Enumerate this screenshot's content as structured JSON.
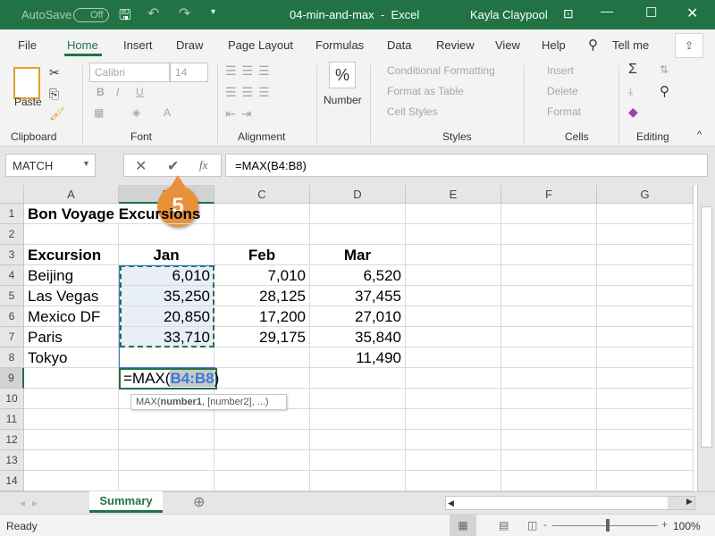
{
  "titlebar": {
    "autosave": "AutoSave",
    "autosave_state": "Off",
    "filename": "04-min-and-max",
    "app": "Excel",
    "user": "Kayla Claypool"
  },
  "menu": [
    "File",
    "Home",
    "Insert",
    "Draw",
    "Page Layout",
    "Formulas",
    "Data",
    "Review",
    "View",
    "Help"
  ],
  "tell_me": "Tell me",
  "ribbon": {
    "clipboard": {
      "label": "Clipboard",
      "paste": "Paste"
    },
    "font": {
      "label": "Font",
      "name": "Calibri",
      "size": "14",
      "bold": "B",
      "italic": "I",
      "underline": "U"
    },
    "alignment": {
      "label": "Alignment"
    },
    "number": {
      "label": "Number",
      "symbol": "%"
    },
    "styles": {
      "label": "Styles",
      "items": [
        "Conditional Formatting",
        "Format as Table",
        "Cell Styles"
      ]
    },
    "cells": {
      "label": "Cells",
      "items": [
        "Insert",
        "Delete",
        "Format"
      ]
    },
    "editing": {
      "label": "Editing"
    }
  },
  "formula_bar": {
    "name_box": "MATCH",
    "formula": "=MAX(B4:B8)",
    "fx": "fx"
  },
  "callout": "5",
  "columns": [
    "A",
    "B",
    "C",
    "D",
    "E",
    "F",
    "G"
  ],
  "rows": [
    {
      "n": "1",
      "cells": [
        "Bon Voyage Excursions",
        "",
        "",
        ""
      ]
    },
    {
      "n": "2",
      "cells": [
        "",
        "",
        "",
        ""
      ]
    },
    {
      "n": "3",
      "cells": [
        "Excursion",
        "Jan",
        "Feb",
        "Mar"
      ]
    },
    {
      "n": "4",
      "cells": [
        "Beijing",
        "6,010",
        "7,010",
        "6,520"
      ]
    },
    {
      "n": "5",
      "cells": [
        "Las Vegas",
        "35,250",
        "28,125",
        "37,455"
      ]
    },
    {
      "n": "6",
      "cells": [
        "Mexico DF",
        "20,850",
        "17,200",
        "27,010"
      ]
    },
    {
      "n": "7",
      "cells": [
        "Paris",
        "33,710",
        "29,175",
        "35,840"
      ]
    },
    {
      "n": "8",
      "cells": [
        "Tokyo",
        "",
        "",
        "11,490"
      ]
    },
    {
      "n": "9",
      "cells": [
        "",
        "",
        "",
        ""
      ]
    },
    {
      "n": "10",
      "cells": [
        "",
        "",
        "",
        ""
      ]
    },
    {
      "n": "11",
      "cells": [
        "",
        "",
        "",
        ""
      ]
    },
    {
      "n": "12",
      "cells": [
        "",
        "",
        "",
        ""
      ]
    },
    {
      "n": "13",
      "cells": [
        "",
        "",
        "",
        ""
      ]
    },
    {
      "n": "14",
      "cells": [
        "",
        "",
        "",
        ""
      ]
    }
  ],
  "edit_cell": {
    "prefix": "=MAX(",
    "ref": "B4:B8",
    "suffix": ")"
  },
  "tooltip": {
    "fn": "MAX(",
    "arg1": "number1",
    "rest": ", [number2], ...)"
  },
  "sheet_tab": "Summary",
  "status": {
    "text": "Ready",
    "zoom": "100%"
  },
  "colors": {
    "brand": "#217346",
    "range": "#3c78d8",
    "selection_fill": "#e8eff9",
    "callout": "#e8913a"
  }
}
